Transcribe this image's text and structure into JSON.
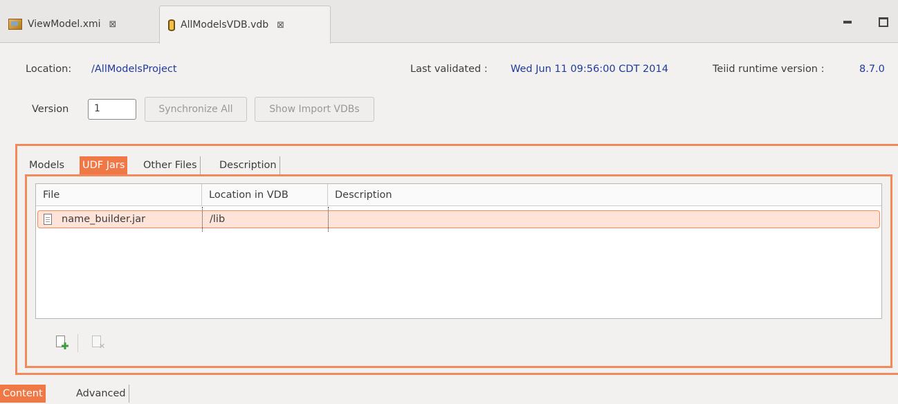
{
  "editor_tabs": [
    {
      "label": "ViewModel.xmi",
      "icon": "model-package-icon"
    },
    {
      "label": "AllModelsVDB.vdb",
      "icon": "vdb-database-icon"
    }
  ],
  "tab_close_glyph": "⊠",
  "header": {
    "location_label": "Location:",
    "location_value": "/AllModelsProject",
    "last_validated_label": "Last validated :",
    "last_validated_value": "Wed Jun 11 09:56:00 CDT 2014",
    "runtime_label": "Teiid runtime version :",
    "runtime_value": "8.7.0"
  },
  "version": {
    "label": "Version",
    "value": "1"
  },
  "buttons": {
    "synchronize": "Synchronize All",
    "show_import": "Show Import VDBs"
  },
  "content_tabs": [
    "Models",
    "UDF Jars",
    "Other Files",
    "Description"
  ],
  "content_tab_selected": "UDF Jars",
  "table": {
    "columns": [
      "File",
      "Location in VDB",
      "Description"
    ],
    "rows": [
      {
        "file": "name_builder.jar",
        "location": "/lib",
        "description": ""
      }
    ]
  },
  "toolbar": {
    "add_icon": "add-file-icon",
    "remove_icon": "remove-file-icon"
  },
  "bottom_tabs": [
    "Content",
    "Advanced"
  ],
  "bottom_tab_selected": "Content",
  "colors": {
    "accent": "#f07746",
    "link_value": "#1f3a9a",
    "selected_row": "#fde3d8"
  }
}
